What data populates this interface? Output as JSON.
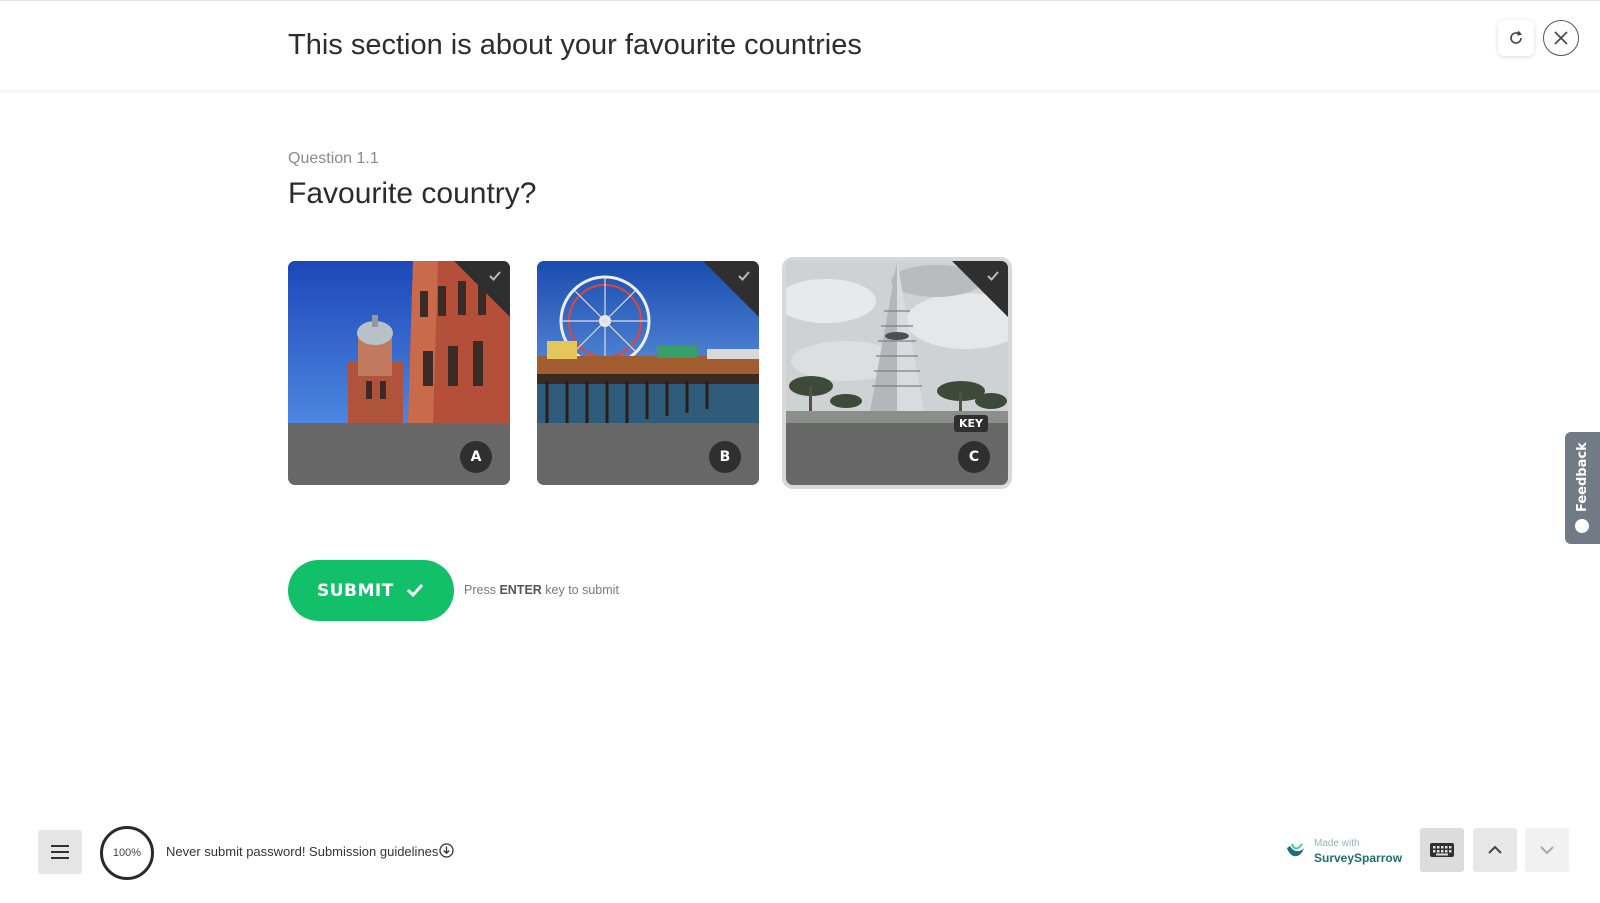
{
  "header": {
    "section_title": "This section is about your favourite countries"
  },
  "question": {
    "number": "Question 1.1",
    "title": "Favourite country?"
  },
  "choices": [
    {
      "letter": "A",
      "image": "red-brick-building-photo",
      "selected": false
    },
    {
      "letter": "B",
      "image": "ferris-wheel-pier-photo",
      "selected": false
    },
    {
      "letter": "C",
      "image": "skyscraper-tower-photo",
      "selected": true,
      "key_hint": "KEY"
    }
  ],
  "submit": {
    "label": "SUBMIT",
    "hint_prefix": "Press ",
    "hint_key": "ENTER",
    "hint_suffix": " key to submit",
    "color": "#12c06a"
  },
  "feedback_tab": {
    "label": "Feedback"
  },
  "footer": {
    "progress": "100%",
    "guidelines_text": "Never submit password! Submission guidelines",
    "brand_made_with": "Made with",
    "brand_name": "SurveySparrow"
  },
  "icons": {
    "refresh": "refresh-icon",
    "close": "close-icon",
    "menu": "menu-icon",
    "keyboard": "keyboard-icon",
    "up": "chevron-up-icon",
    "down": "chevron-down-icon",
    "info": "info-download-icon"
  }
}
